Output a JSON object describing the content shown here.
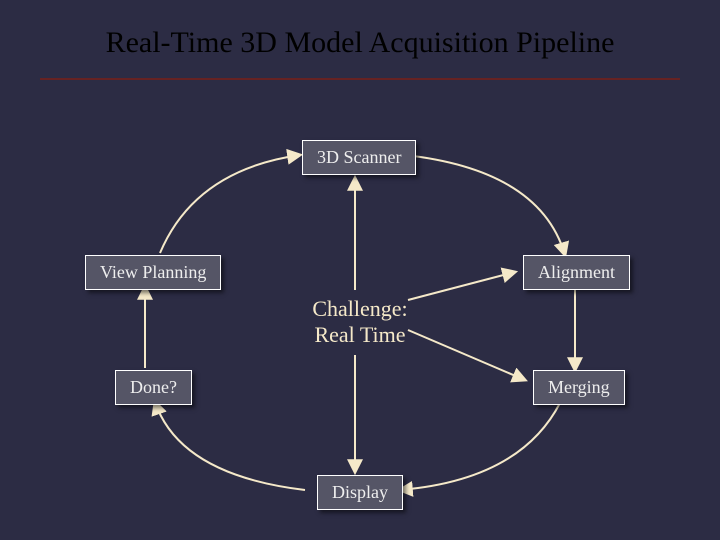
{
  "title": "Real-Time 3D Model Acquisition Pipeline",
  "nodes": {
    "scanner": "3D Scanner",
    "alignment": "Alignment",
    "merging": "Merging",
    "display": "Display",
    "done": "Done?",
    "view_planning": "View Planning"
  },
  "center": {
    "line1": "Challenge:",
    "line2": "Real Time"
  }
}
